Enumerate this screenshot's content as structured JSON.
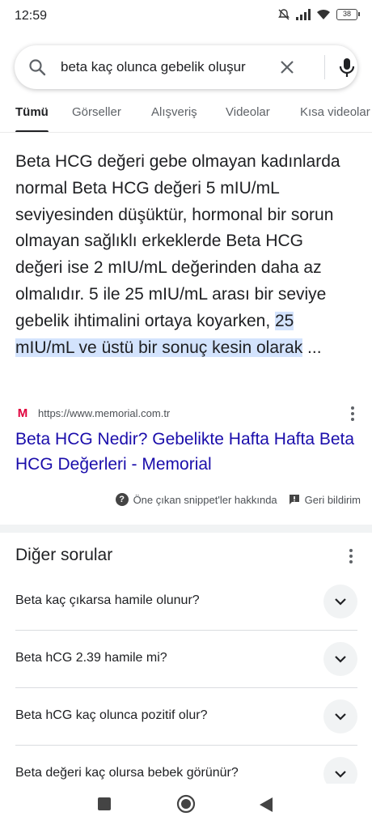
{
  "status_bar": {
    "time": "12:59",
    "battery": "38",
    "icons": [
      "mute-icon",
      "signal-icon",
      "wifi-icon",
      "battery-icon"
    ]
  },
  "search": {
    "query": "beta kaç olunca gebelik oluşur",
    "icons": [
      "search-icon",
      "close-icon",
      "mic-icon"
    ]
  },
  "tabs": [
    {
      "label": "Tümü",
      "active": true
    },
    {
      "label": "Görseller",
      "active": false
    },
    {
      "label": "Alışveriş",
      "active": false
    },
    {
      "label": "Videolar",
      "active": false
    },
    {
      "label": "Kısa videolar",
      "active": false
    }
  ],
  "snippet": {
    "text_plain": "Beta HCG değeri gebe olmayan kadınlarda normal Beta HCG değeri 5 mIU/mL seviyesinden düşüktür, hormonal bir sorun olmayan sağlıklı erkeklerde Beta HCG değeri ise 2 mIU/mL değerinden daha az olmalıdır. 5 ile 25 mIU/mL arası bir seviye gebelik ihtimalini ortaya koyarken, ",
    "text_highlight": "25 mIU/mL ve üstü bir sonuç kesin olarak",
    "text_tail": " ...",
    "source_favicon": "M",
    "source_url": "https://www.memorial.com.tr",
    "link_title": "Beta HCG Nedir? Gebelikte Hafta Hafta Beta HCG Değerleri - Memorial",
    "footer_about": "Öne çıkan snippet'ler hakkında",
    "footer_feedback": "Geri bildirim"
  },
  "related": {
    "title": "Diğer sorular",
    "questions": [
      "Beta kaç çıkarsa hamile olunur?",
      "Beta hCG 2.39 hamile mi?",
      "Beta hCG kaç olunca pozitif olur?",
      "Beta değeri kaç olursa bebek görünür?"
    ]
  },
  "nav_bar": {
    "icons": [
      "recents-icon",
      "home-icon",
      "back-icon"
    ]
  },
  "colors": {
    "link": "#1a0dab",
    "highlight": "#d3e3fd",
    "favicon": "#e0003c"
  }
}
